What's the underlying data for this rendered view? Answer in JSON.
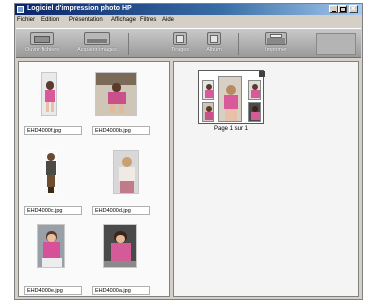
{
  "window": {
    "title": "Logiciel d'impression photo HP"
  },
  "menu": [
    "Fichier",
    "Edition",
    "Présentation",
    "Affichage",
    "Filtres",
    "Aide"
  ],
  "toolbar": {
    "buttons": [
      {
        "label": "Ouvrir fichiers",
        "icon": "open-folder-icon"
      },
      {
        "label": "Acquérir images",
        "icon": "scanner-icon"
      },
      {
        "label": "Tirages",
        "icon": "prints-icon"
      },
      {
        "label": "Album",
        "icon": "album-icon"
      },
      {
        "label": "Imprimer",
        "icon": "printer-icon"
      }
    ]
  },
  "thumbnails": [
    {
      "filename": "EHD4000f.jpg"
    },
    {
      "filename": "EHD4000b.jpg"
    },
    {
      "filename": "EHD4000c.jpg"
    },
    {
      "filename": "EHD4000d.jpg"
    },
    {
      "filename": "EHD4000e.jpg"
    },
    {
      "filename": "EHD4000a.jpg"
    }
  ],
  "preview": {
    "page_label": "Page 1 sur 1"
  },
  "colors": {
    "title_bar": "#0a246a",
    "toolbar": "#a9a9a9",
    "window": "#d4d0c8"
  }
}
